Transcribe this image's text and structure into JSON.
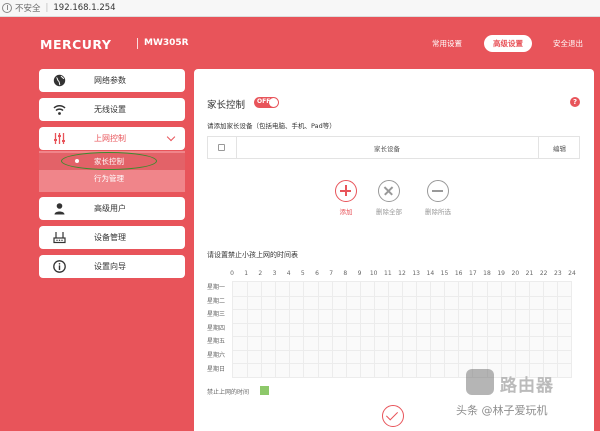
{
  "browser": {
    "security_label": "不安全",
    "url": "192.168.1.254"
  },
  "header": {
    "brand": "MERCURY",
    "model": "MW305R",
    "nav": {
      "quick_setup": "常用设置",
      "advanced_setup": "高级设置",
      "exit": "安全退出"
    }
  },
  "sidebar": {
    "items": [
      {
        "label": "网络参数",
        "icon": "globe-icon"
      },
      {
        "label": "无线设置",
        "icon": "wifi-icon"
      },
      {
        "label": "上网控制",
        "icon": "sliders-icon"
      },
      {
        "label": "高级用户",
        "icon": "user-icon"
      },
      {
        "label": "设备管理",
        "icon": "router-icon"
      },
      {
        "label": "设置向导",
        "icon": "info-icon"
      }
    ],
    "sub_items": [
      {
        "label": "家长控制"
      },
      {
        "label": "行为管理"
      }
    ]
  },
  "main": {
    "title": "家长控制",
    "toggle_label": "OFF",
    "help": "?",
    "add_devices_hint": "请添加家长设备（包括电脑、手机、Pad等）",
    "table": {
      "col_device": "家长设备",
      "col_edit": "编辑"
    },
    "actions": {
      "add": "添加",
      "delete_all": "删除全部",
      "delete_selected": "删除所选"
    },
    "schedule_title": "请设置禁止小孩上网的时间表",
    "hours": [
      "0",
      "1",
      "2",
      "3",
      "4",
      "5",
      "6",
      "7",
      "8",
      "9",
      "10",
      "11",
      "12",
      "13",
      "14",
      "15",
      "16",
      "17",
      "18",
      "19",
      "20",
      "21",
      "22",
      "23",
      "24"
    ],
    "days": [
      "星期一",
      "星期二",
      "星期三",
      "星期四",
      "星期五",
      "星期六",
      "星期日"
    ],
    "legend": "禁止上网的时间",
    "legend_color": "#8dc86a"
  },
  "watermark": {
    "brand": "路由器",
    "source": "头条 @林子爱玩机"
  },
  "colors": {
    "accent": "#e8545a",
    "highlight_ellipse": "#3d8b2f"
  }
}
